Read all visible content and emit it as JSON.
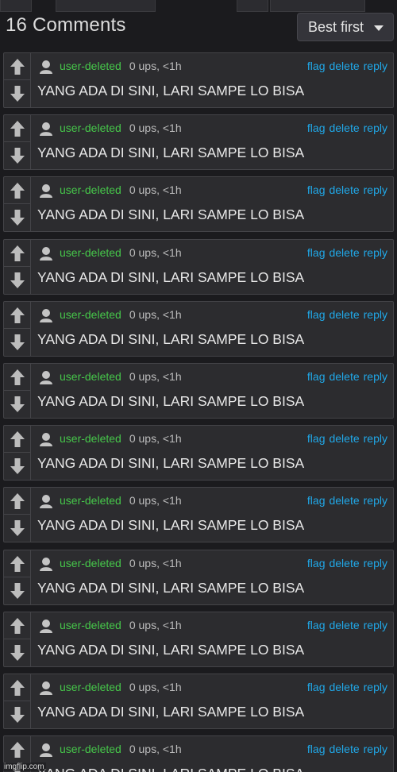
{
  "header": {
    "title": "16 Comments",
    "sort": {
      "selected": "Best first"
    }
  },
  "comment_labels": {
    "flag": "flag",
    "delete": "delete",
    "reply": "reply"
  },
  "comments": [
    {
      "username": "user-deleted",
      "stats": "0 ups, <1h",
      "text": "YANG ADA DI SINI, LARI SAMPE LO BISA"
    },
    {
      "username": "user-deleted",
      "stats": "0 ups, <1h",
      "text": "YANG ADA DI SINI, LARI SAMPE LO BISA"
    },
    {
      "username": "user-deleted",
      "stats": "0 ups, <1h",
      "text": "YANG ADA DI SINI, LARI SAMPE LO BISA"
    },
    {
      "username": "user-deleted",
      "stats": "0 ups, <1h",
      "text": "YANG ADA DI SINI, LARI SAMPE LO BISA"
    },
    {
      "username": "user-deleted",
      "stats": "0 ups, <1h",
      "text": "YANG ADA DI SINI, LARI SAMPE LO BISA"
    },
    {
      "username": "user-deleted",
      "stats": "0 ups, <1h",
      "text": "YANG ADA DI SINI, LARI SAMPE LO BISA"
    },
    {
      "username": "user-deleted",
      "stats": "0 ups, <1h",
      "text": "YANG ADA DI SINI, LARI SAMPE LO BISA"
    },
    {
      "username": "user-deleted",
      "stats": "0 ups, <1h",
      "text": "YANG ADA DI SINI, LARI SAMPE LO BISA"
    },
    {
      "username": "user-deleted",
      "stats": "0 ups, <1h",
      "text": "YANG ADA DI SINI, LARI SAMPE LO BISA"
    },
    {
      "username": "user-deleted",
      "stats": "0 ups, <1h",
      "text": "YANG ADA DI SINI, LARI SAMPE LO BISA"
    },
    {
      "username": "user-deleted",
      "stats": "0 ups, <1h",
      "text": "YANG ADA DI SINI, LARI SAMPE LO BISA"
    },
    {
      "username": "user-deleted",
      "stats": "0 ups, <1h",
      "text": "YANG ADA DI SINI, LARI SAMPE LO BISA"
    }
  ],
  "icons": {
    "upvote": "arrow-up-icon",
    "downvote": "arrow-down-icon",
    "avatar": "user-avatar-icon",
    "sort_caret": "caret-down-icon"
  },
  "colors": {
    "background": "#1b1b1e",
    "card": "#2c2c2f",
    "username": "#46c74a",
    "action_link": "#20a8e8",
    "text": "#e8e8e8"
  },
  "watermark": "imgflip.com"
}
